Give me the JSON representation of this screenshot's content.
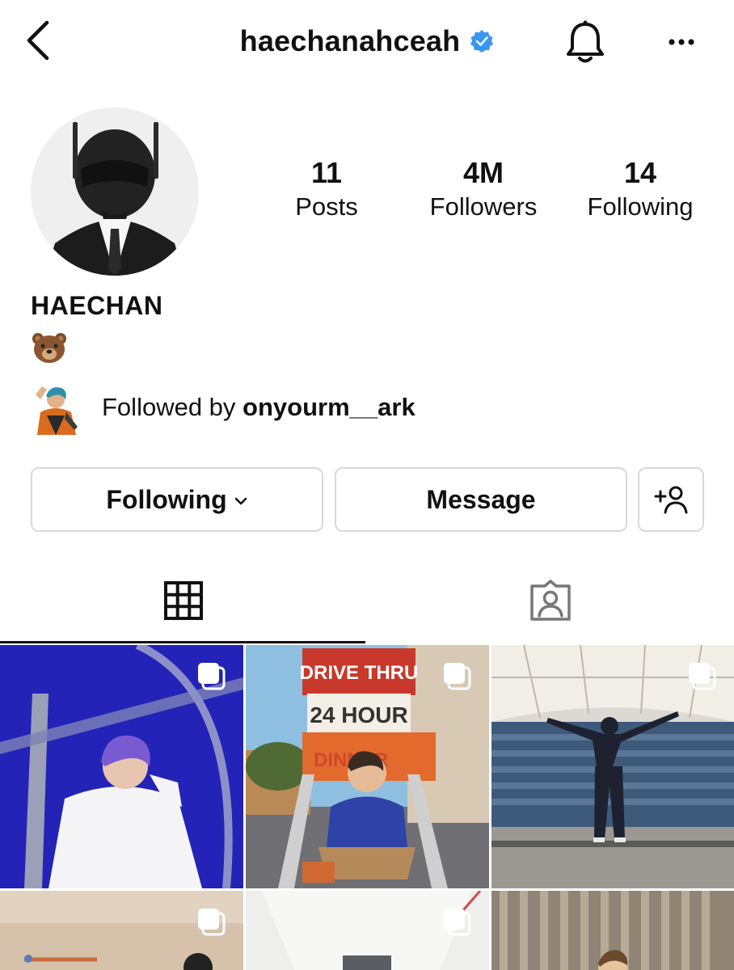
{
  "header": {
    "handle": "haechanahceah",
    "icons": {
      "back": "chevron-left-icon",
      "verified": "verified-badge-icon",
      "bell": "bell-icon",
      "more": "more-horizontal-icon"
    }
  },
  "profile": {
    "display_name": "HAECHAN",
    "bio_emoji": "bear-face-emoji",
    "stats": [
      {
        "value": "11",
        "label": "Posts"
      },
      {
        "value": "4M",
        "label": "Followers"
      },
      {
        "value": "14",
        "label": "Following"
      }
    ],
    "followed_by": {
      "prefix": "Followed by",
      "user": "onyourm__ark"
    }
  },
  "actions": {
    "following_label": "Following",
    "message_label": "Message",
    "add_icon": "add-person-icon"
  },
  "tabs": [
    {
      "icon": "grid-icon",
      "active": true
    },
    {
      "icon": "tagged-person-icon",
      "active": false
    }
  ],
  "colors": {
    "verified": "#3897f0",
    "border": "#d9d9d9",
    "text": "#111111"
  },
  "posts": [
    {
      "multi": true
    },
    {
      "multi": true,
      "sign_top": "DRIVE THRU",
      "sign_mid": "24 HOUR",
      "sign_bottom": "DINNER"
    },
    {
      "multi": true
    },
    {
      "multi": true
    },
    {
      "multi": true
    },
    {
      "multi": false
    }
  ]
}
